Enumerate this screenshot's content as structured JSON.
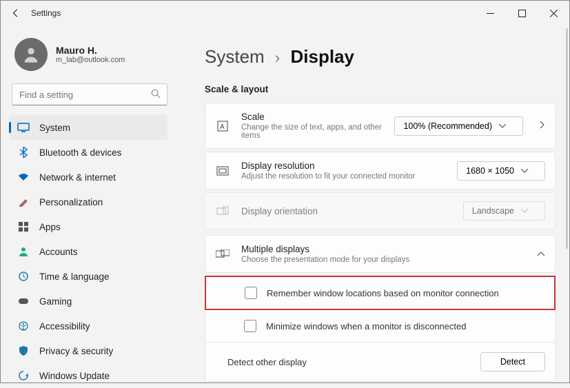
{
  "window": {
    "title": "Settings"
  },
  "user": {
    "name": "Mauro H.",
    "email": "m_lab@outlook.com"
  },
  "search": {
    "placeholder": "Find a setting"
  },
  "nav": [
    {
      "id": "system",
      "label": "System",
      "selected": true
    },
    {
      "id": "bluetooth",
      "label": "Bluetooth & devices"
    },
    {
      "id": "network",
      "label": "Network & internet"
    },
    {
      "id": "personalization",
      "label": "Personalization"
    },
    {
      "id": "apps",
      "label": "Apps"
    },
    {
      "id": "accounts",
      "label": "Accounts"
    },
    {
      "id": "time",
      "label": "Time & language"
    },
    {
      "id": "gaming",
      "label": "Gaming"
    },
    {
      "id": "accessibility",
      "label": "Accessibility"
    },
    {
      "id": "privacy",
      "label": "Privacy & security"
    },
    {
      "id": "update",
      "label": "Windows Update"
    }
  ],
  "breadcrumb": {
    "root": "System",
    "current": "Display"
  },
  "section_header": "Scale & layout",
  "cards": {
    "scale": {
      "title": "Scale",
      "desc": "Change the size of text, apps, and other items",
      "value": "100% (Recommended)"
    },
    "resolution": {
      "title": "Display resolution",
      "desc": "Adjust the resolution to fit your connected monitor",
      "value": "1680 × 1050"
    },
    "orientation": {
      "title": "Display orientation",
      "value": "Landscape"
    },
    "multiple": {
      "title": "Multiple displays",
      "desc": "Choose the presentation mode for your displays"
    }
  },
  "subs": {
    "remember": "Remember window locations based on monitor connection",
    "minimize": "Minimize windows when a monitor is disconnected",
    "detect_label": "Detect other display",
    "detect_btn": "Detect"
  }
}
